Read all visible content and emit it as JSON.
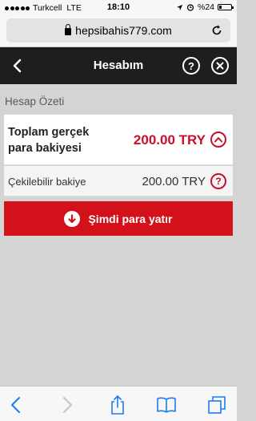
{
  "status_bar": {
    "carrier": "Turkcell",
    "network": "LTE",
    "time": "18:10",
    "battery": "%24",
    "battery_level": 0.24
  },
  "browser": {
    "url": "hepsibahis779.com"
  },
  "header": {
    "title": "Hesabım",
    "help_label": "?",
    "back_icon": "chevron-left-icon",
    "close_icon": "close-icon"
  },
  "summary": {
    "section_title": "Hesap Özeti",
    "total_label": "Toplam gerçek para bakiyesi",
    "total_amount": "200.00 TRY",
    "withdrawable_label": "Çekilebilir bakiye",
    "withdrawable_amount": "200.00 TRY",
    "info_label": "?"
  },
  "deposit": {
    "label": "Şimdi para yatır"
  },
  "colors": {
    "accent": "#d2111b",
    "header_bg": "#1e1e1e",
    "amount_red": "#c8102e"
  }
}
